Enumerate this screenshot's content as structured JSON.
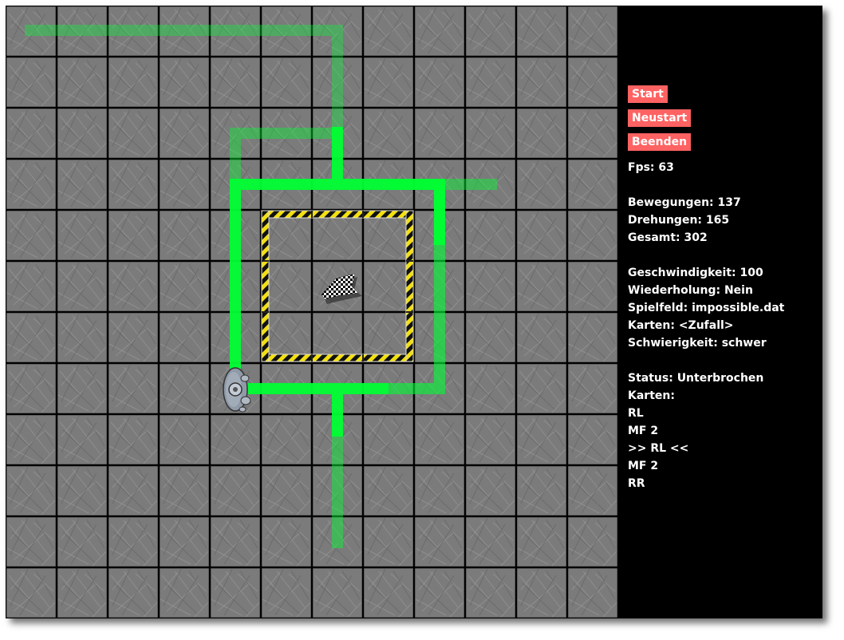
{
  "buttons": {
    "start": "Start",
    "restart": "Neustart",
    "quit": "Beenden"
  },
  "stats": {
    "fps": "Fps: 63",
    "moves": "Bewegungen: 137",
    "turns": "Drehungen: 165",
    "total": "Gesamt: 302",
    "speed": "Geschwindigkeit: 100",
    "repeat": "Wiederholung: Nein",
    "board": "Spielfeld: impossible.dat",
    "cards_mode": "Karten: <Zufall>",
    "difficulty": "Schwierigkeit: schwer",
    "status": "Status: Unterbrochen",
    "cards_label": "Karten:"
  },
  "cards": [
    "RL",
    "MF 2",
    ">> RL <<",
    "MF 2",
    "RR"
  ],
  "colors": {
    "button": "#ff6262",
    "path": "#00ff33",
    "panel": "#000000",
    "tile": "#7a7a7a"
  },
  "icons": {
    "robot": "robot-icon",
    "goal": "checkered-flag-icon"
  }
}
